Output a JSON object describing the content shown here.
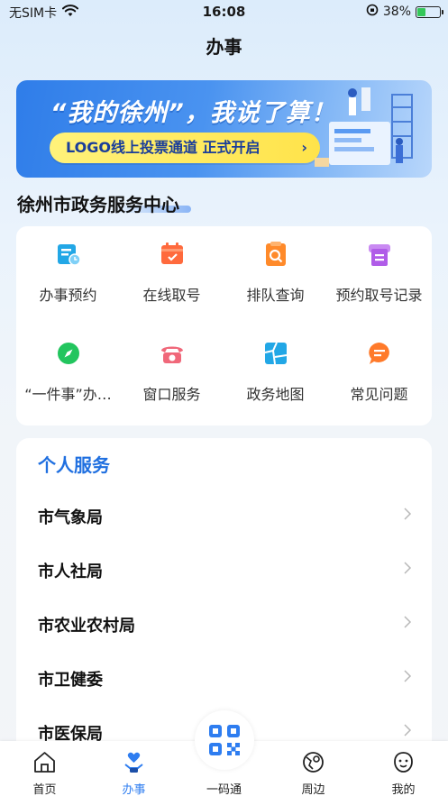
{
  "status_bar": {
    "carrier": "无SIM卡",
    "time": "16:08",
    "battery": "38%",
    "battery_level": 0.38
  },
  "nav": {
    "title": "办事"
  },
  "banner": {
    "title": "“我的徐州”，我说了算！",
    "pill_text": "LOGO线上投票通道 正式开启",
    "pill_chevron": "›"
  },
  "section": {
    "title": "徐州市政务服务中心"
  },
  "services": [
    {
      "label": "办事预约",
      "icon": "calendar-clock-icon",
      "color": "#22a7e6"
    },
    {
      "label": "在线取号",
      "icon": "ticket-icon",
      "color": "#ff6a3d"
    },
    {
      "label": "排队查询",
      "icon": "queue-search-icon",
      "color": "#ff8a2a"
    },
    {
      "label": "预约取号记录",
      "icon": "printer-record-icon",
      "color": "#b05ce8"
    },
    {
      "label": "“一件事”办…",
      "icon": "compass-icon",
      "color": "#22c55e"
    },
    {
      "label": "窗口服务",
      "icon": "telephone-icon",
      "color": "#f0687a"
    },
    {
      "label": "政务地图",
      "icon": "map-icon",
      "color": "#22a7e6"
    },
    {
      "label": "常见问题",
      "icon": "chat-bubble-icon",
      "color": "#ff7a2a"
    }
  ],
  "personal": {
    "title": "个人服务",
    "rows": [
      "市气象局",
      "市人社局",
      "市农业农村局",
      "市卫健委",
      "市医保局"
    ]
  },
  "tabbar": {
    "tabs": [
      {
        "label": "首页",
        "icon": "home-icon"
      },
      {
        "label": "办事",
        "icon": "handshake-heart-icon"
      },
      {
        "label": "一码通",
        "icon": "qr-code-icon"
      },
      {
        "label": "周边",
        "icon": "location-map-icon"
      },
      {
        "label": "我的",
        "icon": "smiley-icon"
      }
    ],
    "active_index": 1
  },
  "colors": {
    "accent": "#2e7df0",
    "section_title": "#1f6fe0"
  }
}
